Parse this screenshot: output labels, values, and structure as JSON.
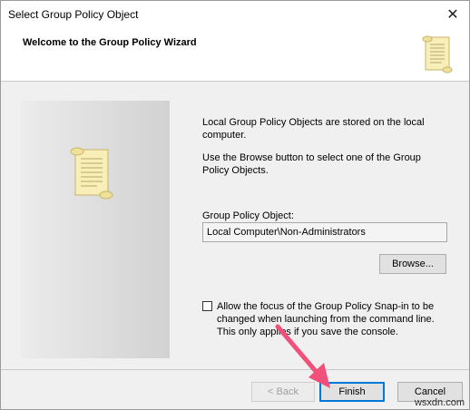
{
  "window": {
    "title": "Select Group Policy Object"
  },
  "header": {
    "title": "Welcome to the Group Policy Wizard",
    "icon": "scroll-icon"
  },
  "body": {
    "paragraph1": "Local Group Policy Objects are stored on the local computer.",
    "paragraph2": "Use the Browse button to select one of the Group Policy Objects.",
    "gpo_label": "Group Policy Object:",
    "gpo_value": "Local Computer\\Non-Administrators",
    "browse_label": "Browse...",
    "checkbox_label": "Allow the focus of the Group Policy Snap-in to be changed when launching from the command line. This only applies if you save the console.",
    "checkbox_checked": false
  },
  "footer": {
    "back_label": "< Back",
    "finish_label": "Finish",
    "cancel_label": "Cancel"
  },
  "watermark": "wsxdn.com",
  "colors": {
    "arrow": "#f0507a",
    "focus_border": "#0078d7"
  }
}
